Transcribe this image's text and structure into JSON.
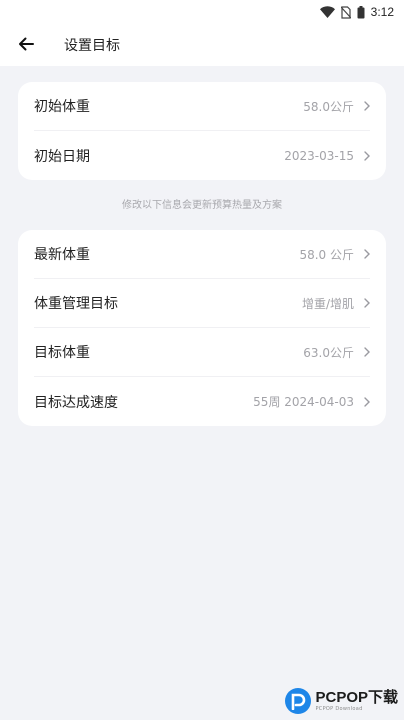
{
  "status_bar": {
    "time": "3:12",
    "icons": [
      "wifi-icon",
      "no-sim-icon",
      "battery-icon"
    ]
  },
  "header": {
    "title": "设置目标",
    "back_icon": "arrow-left-icon"
  },
  "card1": {
    "rows": [
      {
        "label": "初始体重",
        "value": "58.0公斤"
      },
      {
        "label": "初始日期",
        "value": "2023-03-15"
      }
    ]
  },
  "hint": "修改以下信息会更新预算热量及方案",
  "card2": {
    "rows": [
      {
        "label": "最新体重",
        "value": "58.0 公斤"
      },
      {
        "label": "体重管理目标",
        "value": "增重/增肌"
      },
      {
        "label": "目标体重",
        "value": "63.0公斤"
      },
      {
        "label": "目标达成速度",
        "value": "55周 2024-04-03"
      }
    ]
  },
  "watermark": {
    "brand": "PCPOP下载",
    "sub": "PCPOP Download",
    "color": "#1e86e8"
  },
  "colors": {
    "background": "#f2f3f7",
    "card": "#ffffff",
    "value_text": "#a3a3a8"
  }
}
